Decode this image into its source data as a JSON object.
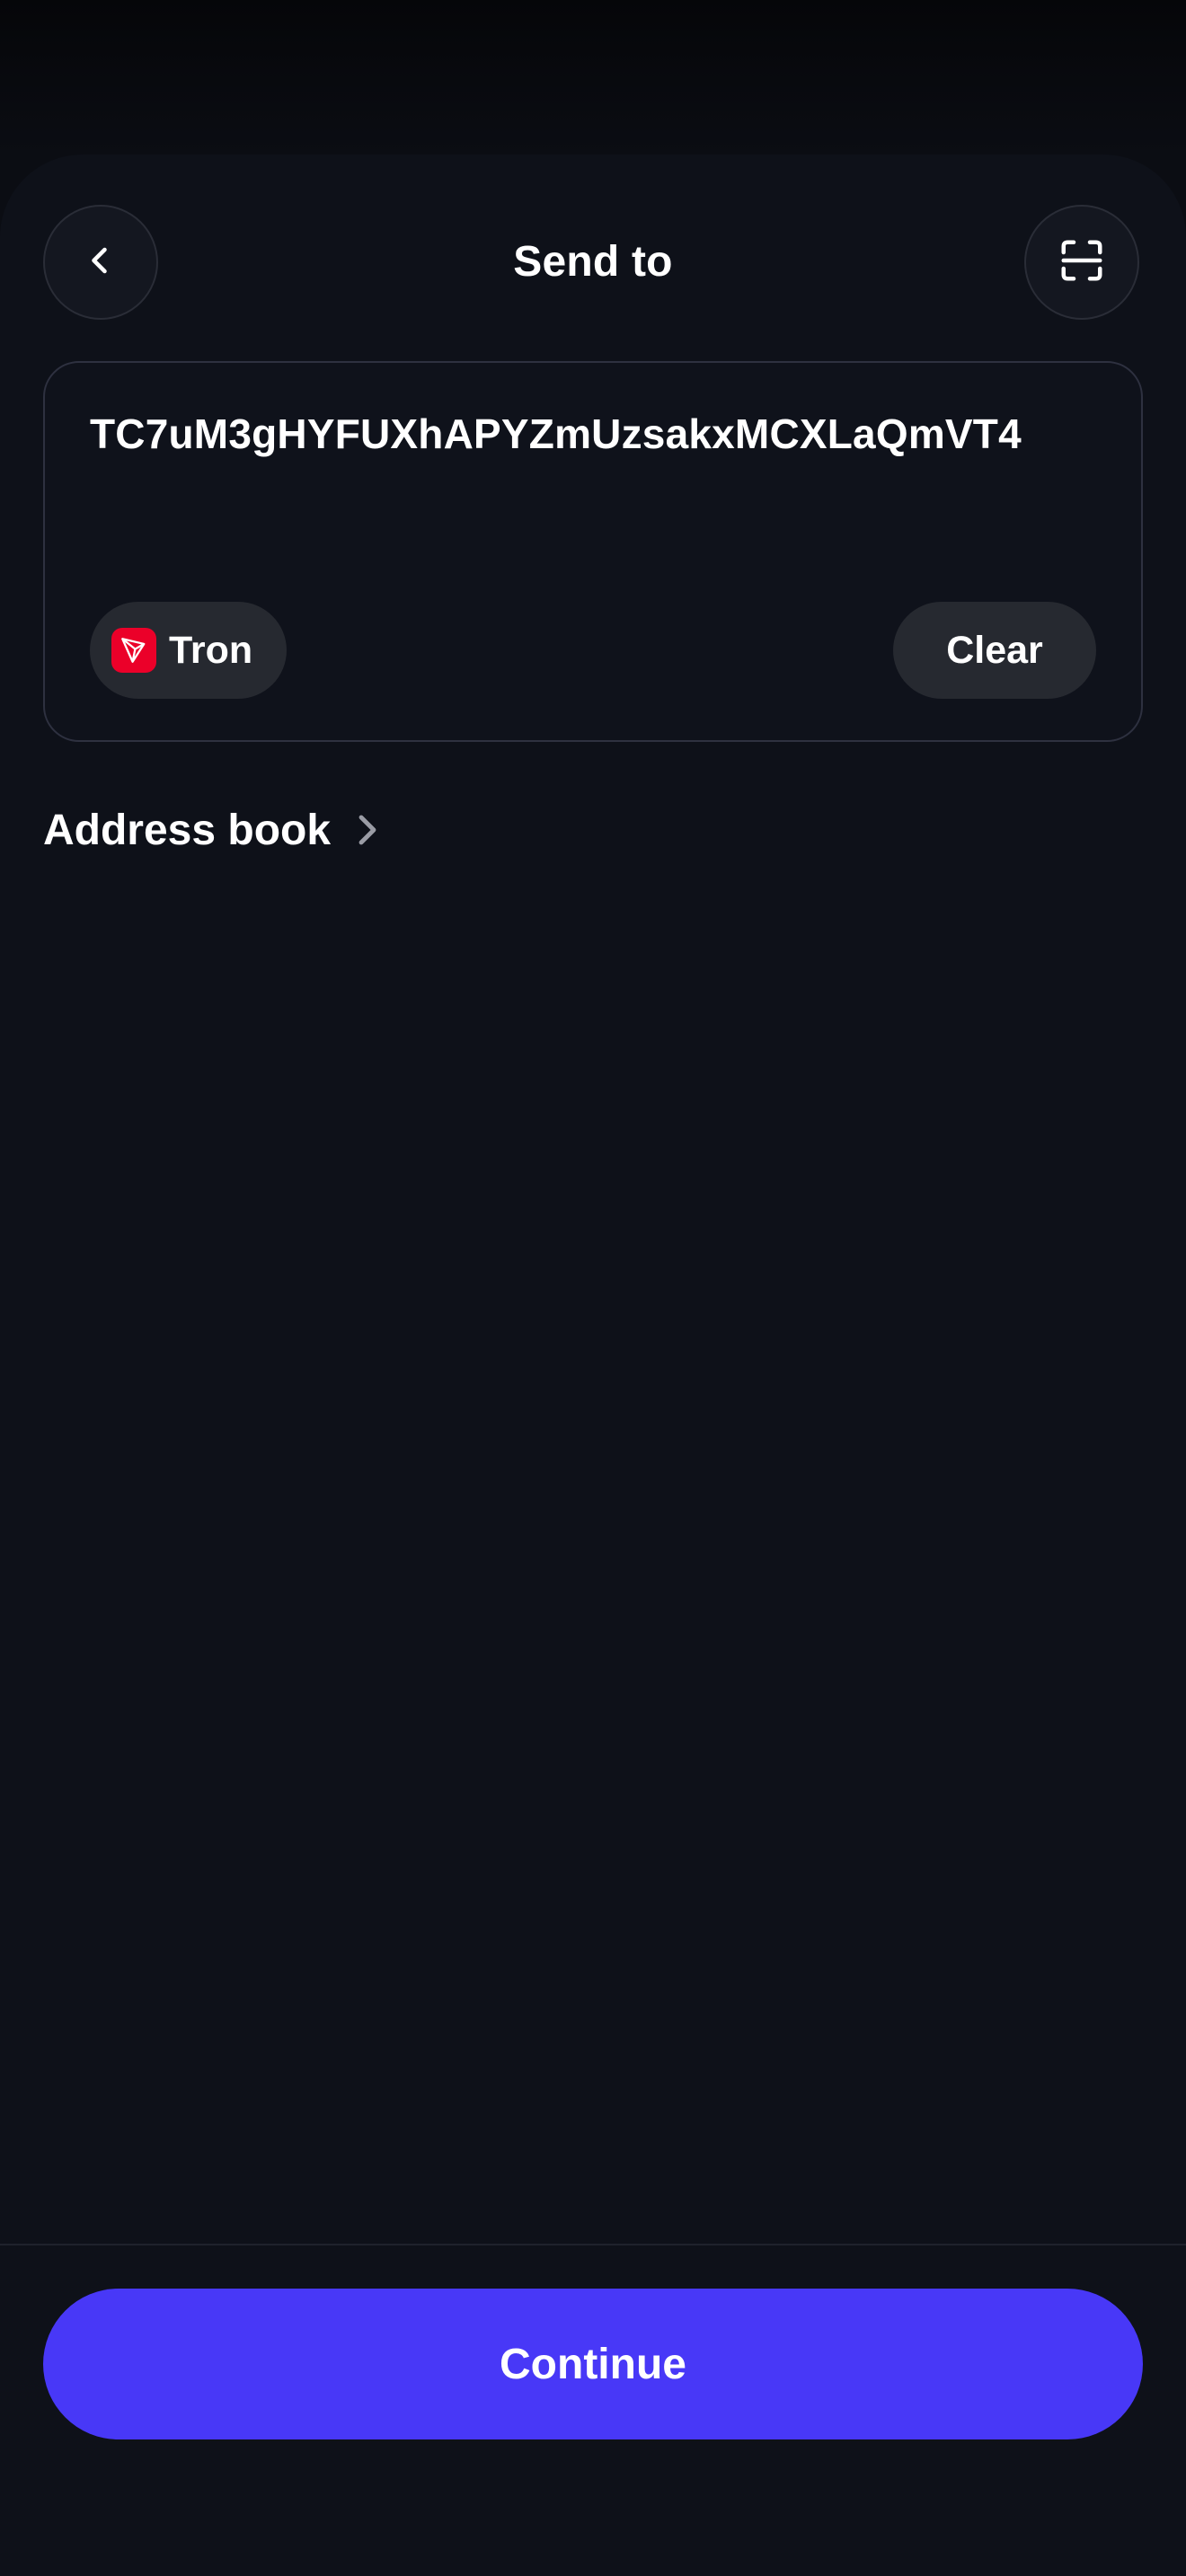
{
  "header": {
    "title": "Send to",
    "back_icon": "chevron-left-icon",
    "scan_icon": "scan-qr-icon"
  },
  "recipient": {
    "address": "TC7uM3gHYFUXhAPYZmUzsakxMCXLaQmVT4",
    "network": {
      "label": "Tron",
      "icon": "tron-logo-icon",
      "icon_color": "#eb0029"
    },
    "clear_label": "Clear"
  },
  "address_book": {
    "label": "Address book",
    "icon": "chevron-right-icon"
  },
  "footer": {
    "continue_label": "Continue"
  },
  "colors": {
    "background": "#0e1119",
    "card_border": "#2e3140",
    "pill_background": "#262930",
    "accent": "#4838f7"
  }
}
